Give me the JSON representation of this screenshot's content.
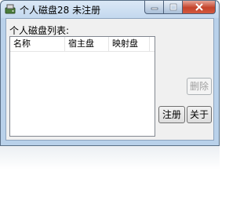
{
  "window": {
    "title": "个人磁盘28 未注册",
    "icon": "disk-app-icon"
  },
  "caption_buttons": {
    "minimize_icon": "minimize-icon",
    "maximize_icon": "maximize-icon",
    "close_icon": "close-icon"
  },
  "main": {
    "list_label": "个人磁盘列表:",
    "columns": [
      "名称",
      "宿主盘",
      "映射盘"
    ],
    "rows": []
  },
  "buttons": {
    "delete_label": "删除",
    "register_label": "注册",
    "about_label": "关于"
  },
  "colors": {
    "frame": "#b9d1ea",
    "client": "#f0f0f0",
    "close_button": "#c4432b"
  }
}
